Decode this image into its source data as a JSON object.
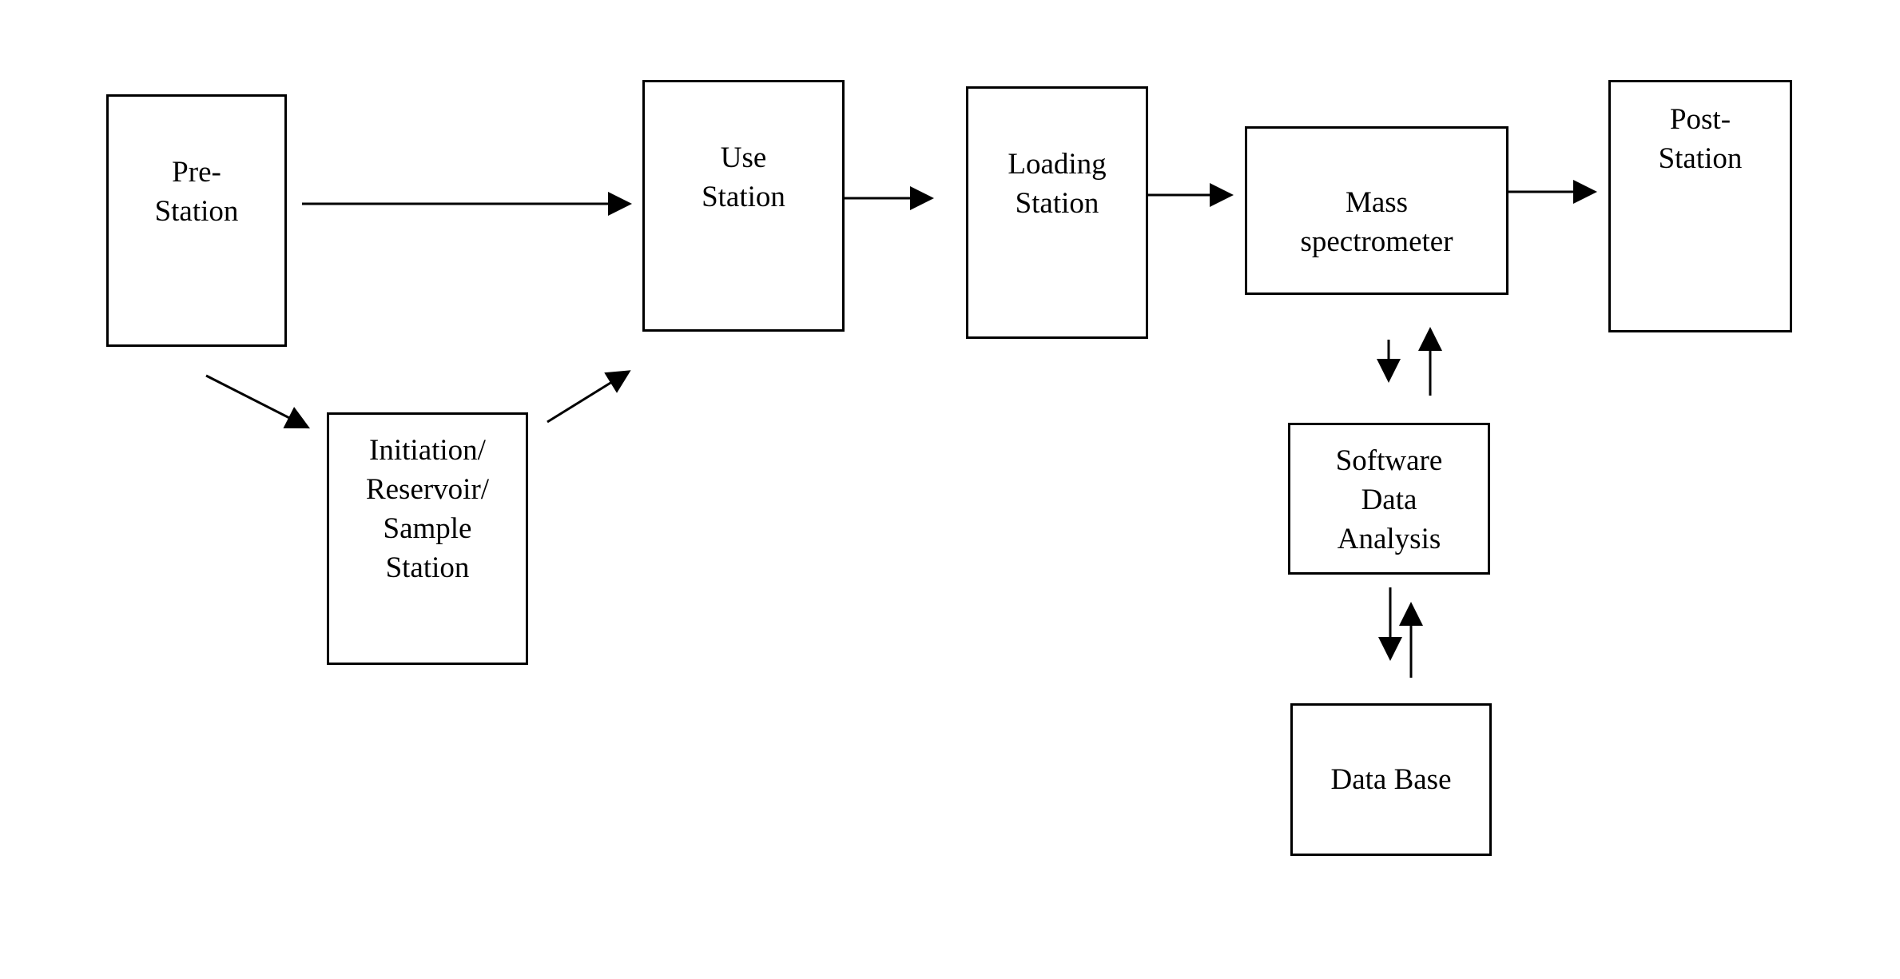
{
  "diagram": {
    "nodes": {
      "pre_station": {
        "lines": [
          "Pre-",
          "Station"
        ]
      },
      "initiation_station": {
        "lines": [
          "Initiation/",
          "Reservoir/",
          "Sample",
          "Station"
        ]
      },
      "use_station": {
        "lines": [
          "Use",
          "Station"
        ]
      },
      "loading_station": {
        "lines": [
          "Loading",
          "Station"
        ]
      },
      "mass_spectrometer": {
        "lines": [
          "Mass",
          "spectrometer"
        ]
      },
      "post_station": {
        "lines": [
          "Post-",
          "Station"
        ]
      },
      "software_data_analysis": {
        "lines": [
          "Software",
          "Data",
          "Analysis"
        ]
      },
      "data_base": {
        "lines": [
          "Data Base"
        ]
      }
    },
    "edges": [
      {
        "from": "pre_station",
        "to": "use_station"
      },
      {
        "from": "pre_station",
        "to": "initiation_station"
      },
      {
        "from": "initiation_station",
        "to": "use_station"
      },
      {
        "from": "use_station",
        "to": "loading_station"
      },
      {
        "from": "loading_station",
        "to": "mass_spectrometer"
      },
      {
        "from": "mass_spectrometer",
        "to": "post_station"
      },
      {
        "from": "mass_spectrometer",
        "to": "software_data_analysis"
      },
      {
        "from": "software_data_analysis",
        "to": "mass_spectrometer"
      },
      {
        "from": "software_data_analysis",
        "to": "data_base"
      },
      {
        "from": "data_base",
        "to": "software_data_analysis"
      }
    ]
  }
}
